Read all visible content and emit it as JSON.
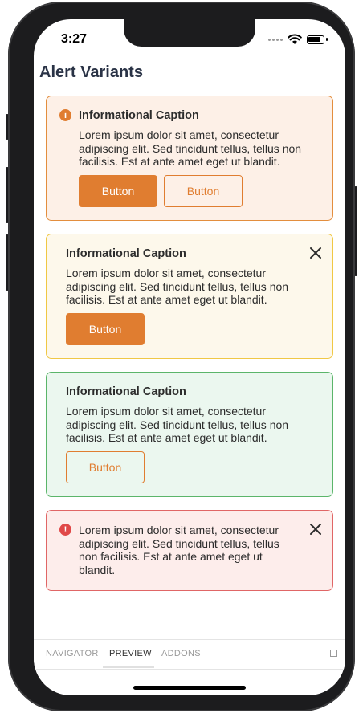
{
  "status": {
    "time": "3:27"
  },
  "page": {
    "title": "Alert Variants"
  },
  "alerts": [
    {
      "variant": "warning",
      "icon": "info-icon",
      "caption": "Informational Caption",
      "body": "Lorem ipsum dolor sit amet, consectetur adipiscing elit. Sed tincidunt tellus, tellus non facilisis. Est at ante amet eget ut blandit.",
      "primary_button": "Button",
      "secondary_button": "Button"
    },
    {
      "variant": "caution",
      "caption": "Informational Caption",
      "body": "Lorem ipsum dolor sit amet, consectetur adipiscing elit. Sed tincidunt tellus, tellus non facilisis. Est at ante amet eget ut blandit.",
      "primary_button": "Button",
      "dismissible": true
    },
    {
      "variant": "success",
      "caption": "Informational Caption",
      "body": "Lorem ipsum dolor sit amet, consectetur adipiscing elit. Sed tincidunt tellus, tellus non facilisis. Est at ante amet eget ut blandit.",
      "secondary_button": "Button"
    },
    {
      "variant": "error",
      "icon": "error-icon",
      "body": "Lorem ipsum dolor sit amet, consectetur adipiscing elit. Sed tincidunt tellus, tellus non facilisis. Est at ante amet eget ut blandit.",
      "dismissible": true
    }
  ],
  "bottom_tabs": [
    {
      "label": "NAVIGATOR"
    },
    {
      "label": "PREVIEW",
      "active": true
    },
    {
      "label": "ADDONS"
    }
  ],
  "colors": {
    "accent": "#e07d30",
    "title": "#2a3346",
    "error": "#e04848"
  }
}
